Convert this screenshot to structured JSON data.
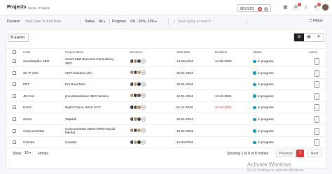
{
  "header": {
    "title": "Projects",
    "breadcrumb": "Home > Projects",
    "timer": "00:01:01",
    "notification_badge": "1",
    "messages_badge": "6"
  },
  "filters": {
    "duration_label": "Duration",
    "duration_value": "Start Date To End Date",
    "status_label": "Status",
    "status_value": "All",
    "progress_label": "Progress",
    "progress_value": "0% - 20%, 21%",
    "search_placeholder": "Start typing to search",
    "filters_label": "Filters"
  },
  "toolbar": {
    "export_label": "Export"
  },
  "table": {
    "columns": [
      "Code",
      "Project Name",
      "Members",
      "Start Date",
      "Deadline",
      "Status",
      "Action"
    ],
    "rows": [
      {
        "code": "Smartstartbc-SEO",
        "name": [
          "Smart Start Business Consultancy",
          "SEO"
        ],
        "start": "14-08-2024",
        "deadline": "14-08-2026",
        "deadline_color": "#222222",
        "status": "in progress",
        "extra": "+2"
      },
      {
        "code": "SK IT USA",
        "name": [
          "SKIT Solution USA"
        ],
        "start": "15-01-2024",
        "deadline": "",
        "deadline_color": "#222222",
        "status": "in progress",
        "extra": "+4"
      },
      {
        "code": "PRT",
        "name": [
          "Pro Real Tech"
        ],
        "start": "10-01-2024",
        "deadline": "",
        "deadline_color": "#222222",
        "status": "in progress",
        "extra": "+3"
      },
      {
        "code": "JM-Con",
        "name": [
          "jmconstructionec SEO Service"
        ],
        "start": "12-01-2024",
        "deadline": "13-10-2024",
        "deadline_color": "#222222",
        "status": "in progress",
        "extra": "+3"
      },
      {
        "code": "HVAC",
        "name": [
          "Right Choice HVAC NYC"
        ],
        "start": "01-11-2023",
        "deadline": "31-03-2024",
        "deadline_color": "#e53935",
        "status": "in progress",
        "extra": "+3"
      },
      {
        "code": "eCom",
        "name": [
          "TaqMall"
        ],
        "start": "15-01-2024",
        "deadline": "",
        "deadline_color": "#222222",
        "status": "in progress",
        "extra": "+2"
      },
      {
        "code": "Cozycornerbar",
        "name": [
          "Cozycornerbar (SEO+ORM+Social",
          "Media)"
        ],
        "start": "16-01-2024",
        "deadline": "",
        "deadline_color": "#222222",
        "status": "in progress",
        "extra": "+3"
      },
      {
        "code": "Coresta",
        "name": [
          "Coresta"
        ],
        "start": "10-03-2024",
        "deadline": "",
        "deadline_color": "#222222",
        "status": "in progress",
        "extra": "+3"
      }
    ]
  },
  "footer": {
    "show_label": "Show",
    "page_size": "10",
    "entries_label": "entries",
    "showing_text": "Showing 1 to 8 of 8 entries",
    "previous_label": "Previous",
    "current_page": "1",
    "next_label": "Next"
  },
  "watermark": {
    "line1": "Activate Windows",
    "line2": "Go to Settings to activate Windows."
  },
  "colors": {
    "accent_red": "#e53935",
    "status_blue": "#1e9bd7"
  }
}
